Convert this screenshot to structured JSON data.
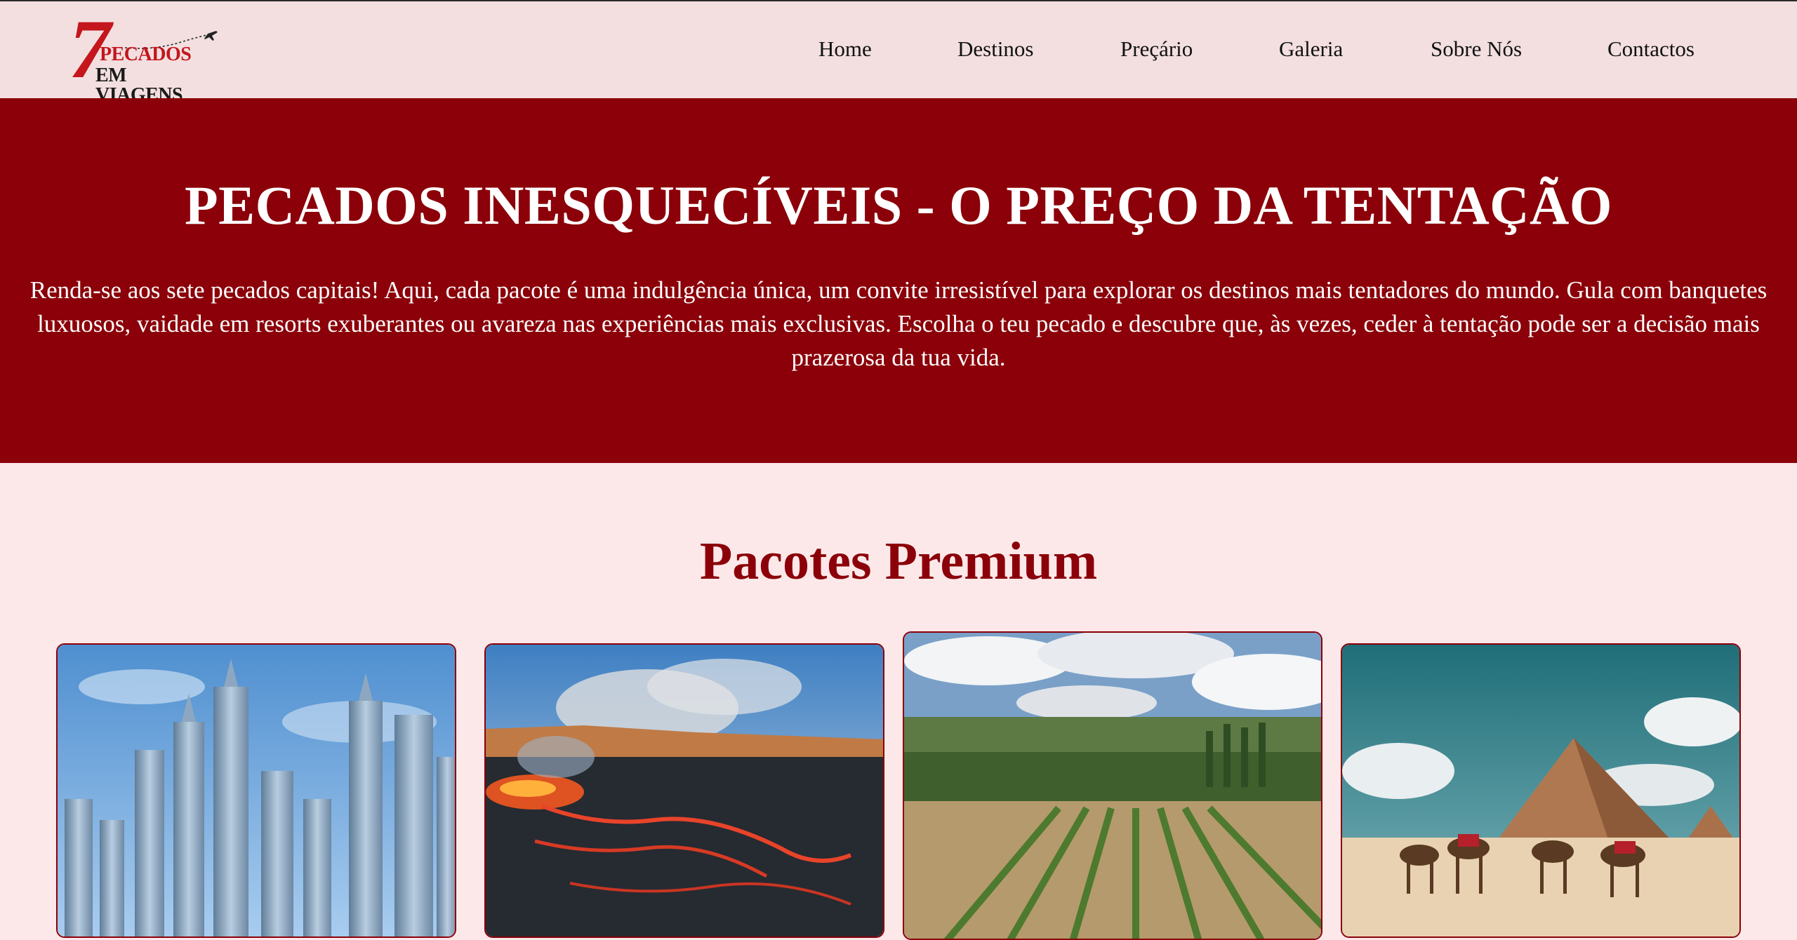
{
  "brand": {
    "logo_number": "7",
    "logo_line1": "PECADOS",
    "logo_line2": "EM VIAGENS"
  },
  "nav": {
    "items": [
      "Home",
      "Destinos",
      "Preçário",
      "Galeria",
      "Sobre Nós",
      "Contactos"
    ]
  },
  "hero": {
    "title": "PECADOS INESQUECÍVEIS - O PREÇO DA TENTAÇÃO",
    "text": "Renda-se aos sete pecados capitais! Aqui, cada pacote é uma indulgência única, um convite irresistível para explorar os destinos mais tentadores do mundo. Gula com banquetes luxuosos, vaidade em resorts exuberantes ou avareza nas experiências mais exclusivas. Escolha o teu pecado e descubre que, às vezes, ceder à tentação pode ser a decisão mais prazerosa da tua vida."
  },
  "packages": {
    "title": "Pacotes Premium",
    "cards": [
      {
        "image": "skyscrapers-city-skyline"
      },
      {
        "image": "volcano-lava-field"
      },
      {
        "image": "vineyard-countryside"
      },
      {
        "image": "pyramid-desert-camels"
      }
    ]
  },
  "colors": {
    "accent": "#8b0009",
    "logo_red": "#c4161c",
    "page_bg": "#fce8e9",
    "header_bg": "#f3dfe0"
  }
}
